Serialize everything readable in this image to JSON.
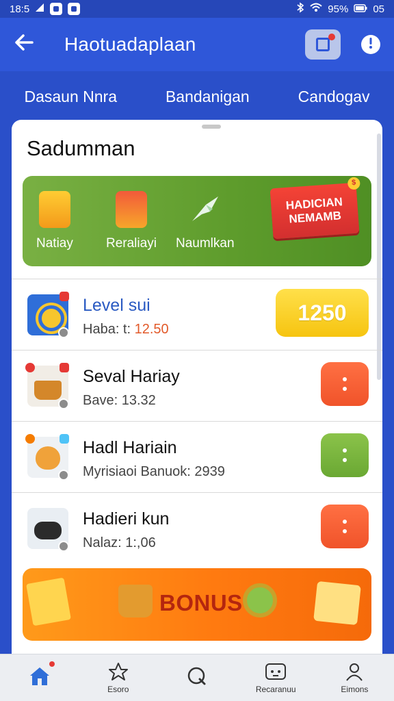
{
  "status_bar": {
    "time": "18:5",
    "battery": "95%",
    "extra": "05"
  },
  "app_bar": {
    "title": "Haotuadaplaan",
    "back_icon": "arrow-left-icon",
    "notify_icon": "inbox-icon",
    "info_icon": "info-icon"
  },
  "tabs": [
    {
      "label": "Dasaun Nnra"
    },
    {
      "label": "Bandanigan"
    },
    {
      "label": "Candogav"
    }
  ],
  "sheet": {
    "title": "Sadumman",
    "promo": {
      "items": [
        {
          "label": "Natiay",
          "icon": "cup-icon"
        },
        {
          "label": "Reraliayi",
          "icon": "gift-box-icon"
        },
        {
          "label": "Naumlkan",
          "icon": "bird-icon"
        }
      ],
      "flag_line1": "HADICIAN",
      "flag_line2": "NEMAMB"
    },
    "list": [
      {
        "name": "Level sui",
        "sub_label": "Haba: t:",
        "sub_value": "12.50",
        "action": "1250",
        "icon": "coin-target-icon"
      },
      {
        "name": "Seval Hariay",
        "sub_label": "Bave: 13.32",
        "action_color": "#f0532a",
        "icon": "basket-icon"
      },
      {
        "name": "Hadl Hariain",
        "sub_label": "Myrisiaoi Banuok: 2939",
        "action_color": "#6aa833",
        "icon": "fox-icon"
      },
      {
        "name": "Hadieri kun",
        "sub_label": "Nalaz: 1:,06",
        "action_color": "#f0532a",
        "icon": "dog-icon"
      }
    ],
    "bonus": {
      "label": "BONUS"
    }
  },
  "bottom_nav": [
    {
      "label": "",
      "icon": "home-icon"
    },
    {
      "label": "Esoro",
      "icon": "star-icon"
    },
    {
      "label": "",
      "icon": "search-icon"
    },
    {
      "label": "Recaranuu",
      "icon": "gamepad-icon"
    },
    {
      "label": "Eimons",
      "icon": "person-icon"
    }
  ],
  "colors": {
    "brand_blue": "#2f57d9",
    "promo_green": "#5e9c2c",
    "score_yellow": "#f6c410",
    "bonus_orange": "#ff7a10"
  }
}
